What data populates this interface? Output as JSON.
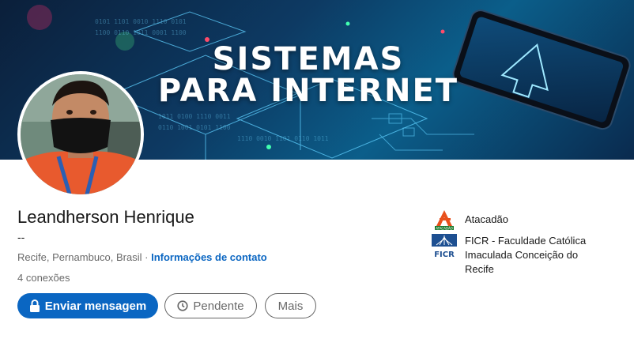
{
  "banner": {
    "line1": "SISTEMAS",
    "line2": "PARA INTERNET"
  },
  "profile": {
    "name": "Leandherson Henrique",
    "headline": "--",
    "location": "Recife, Pernambuco, Brasil",
    "separator": "·",
    "contact_link": "Informações de contato",
    "connections": "4 conexões"
  },
  "actions": {
    "message_label": "Enviar mensagem",
    "pending_label": "Pendente",
    "more_label": "Mais"
  },
  "companies": [
    {
      "name": "Atacadão",
      "icon": "atacadao-logo",
      "logo_text": "ATACADÃO"
    },
    {
      "name": "FICR - Faculdade Católica Imaculada Conceição do Recife",
      "icon": "ficr-logo",
      "logo_text": "FICR"
    }
  ],
  "colors": {
    "accent": "#0a66c2",
    "atacadao": "#e8501c",
    "ficr": "#1d4f91"
  }
}
